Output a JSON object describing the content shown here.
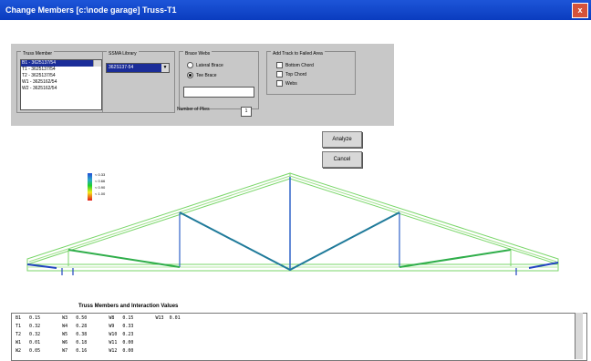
{
  "window": {
    "title": "Change Members [c:\\node garage] Truss-T1",
    "close_label": "x"
  },
  "truss_member": {
    "label": "Truss Member",
    "items": [
      "B1 - 3625137/54",
      "T1 - 3625137/54",
      "T2 - 3625137/54",
      "W1 - 3625162/54",
      "W2 - 3625162/54"
    ],
    "selected_index": 0
  },
  "ssma_library": {
    "label": "SSMA Library",
    "value": "362S137-54"
  },
  "brace_webs": {
    "label": "Brace Webs",
    "options": [
      "Lateral Brace",
      "Tee Brace"
    ],
    "selected_index": 1,
    "number_of_plies_label": "Number of Plies",
    "number_of_plies_value": "1"
  },
  "add_track": {
    "label": "Add Track to Failed Area",
    "options": [
      "Bottom Chord",
      "Top Chord",
      "Webs"
    ]
  },
  "buttons": {
    "analyze": "Analyze",
    "cancel": "Cancel"
  },
  "legend": {
    "items": [
      "< 0.33",
      "< 0.66",
      "< 0.90",
      "< 1.00"
    ],
    "colors": [
      "#1f4fd6",
      "#1bd12b",
      "#f5e71a",
      "#e41a1a"
    ]
  },
  "table": {
    "title": "Truss Members and Interaction Values",
    "rows": [
      "B1   0.15        W3   0.50        W8   0.15        W13  0.01",
      "T1   0.32        W4   0.28        W9   0.33",
      "T2   0.32        W5   0.38        W10  0.23",
      "W1   0.01        W6   0.18        W11  0.00",
      "W2   0.05        W7   0.16        W12  0.00"
    ]
  }
}
